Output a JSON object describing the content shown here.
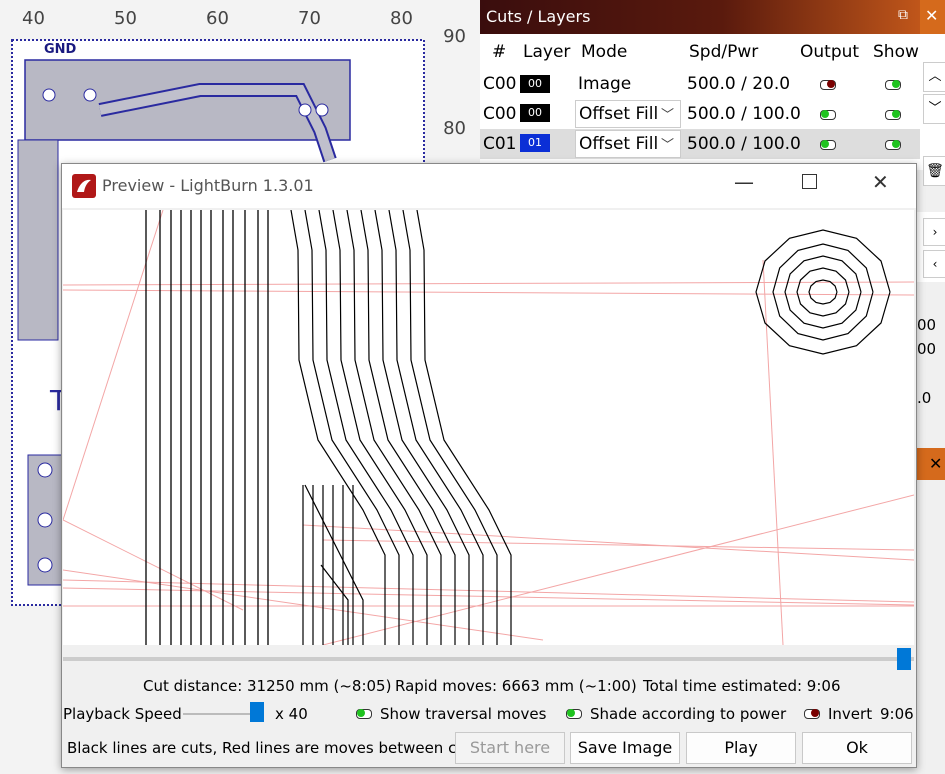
{
  "workspace": {
    "ruler_top": [
      "40",
      "50",
      "60",
      "70",
      "80"
    ],
    "ruler_right": [
      "90",
      "80"
    ],
    "pcb_label": "GND"
  },
  "cuts": {
    "title": "Cuts / Layers",
    "headers": [
      "#",
      "Layer",
      "Mode",
      "Spd/Pwr",
      "Output",
      "Show"
    ],
    "rows": [
      {
        "num": "C00",
        "layer": "00",
        "layer_color": "#000000",
        "mode": "Image",
        "spdpwr": "500.0 / 20.0",
        "output": "off",
        "show": "on"
      },
      {
        "num": "C00",
        "layer": "00",
        "layer_color": "#000000",
        "mode": "Offset Fill",
        "spdpwr": "500.0 / 100.0",
        "output": "on",
        "show": "on"
      },
      {
        "num": "C01",
        "layer": "01",
        "layer_color": "#0b2fd6",
        "mode": "Offset Fill",
        "spdpwr": "500.0 / 100.0",
        "output": "on",
        "show": "on"
      }
    ]
  },
  "side_values": [
    "00",
    "00",
    ".0"
  ],
  "preview": {
    "title": "Preview - LightBurn 1.3.01",
    "stats": {
      "cut_distance": "Cut distance: 31250 mm (~8:05)",
      "rapid_moves": "Rapid moves: 6663 mm (~1:00)",
      "total_time": "Total time estimated: 9:06"
    },
    "playback_label": "Playback Speed",
    "playback_multiplier": "x 40",
    "show_traversal": "Show traversal moves",
    "shade_power": "Shade according to power",
    "invert": "Invert",
    "time_readout": "9:06",
    "legend": "Black lines are cuts, Red lines are moves between cuts",
    "buttons": {
      "start_here": "Start here",
      "save_image": "Save Image",
      "play": "Play",
      "ok": "Ok"
    },
    "progress_fraction": 1.0
  },
  "colors": {
    "accent": "#0078d7",
    "toggle_on": "#1fc31f",
    "toggle_off": "#7a0000"
  }
}
